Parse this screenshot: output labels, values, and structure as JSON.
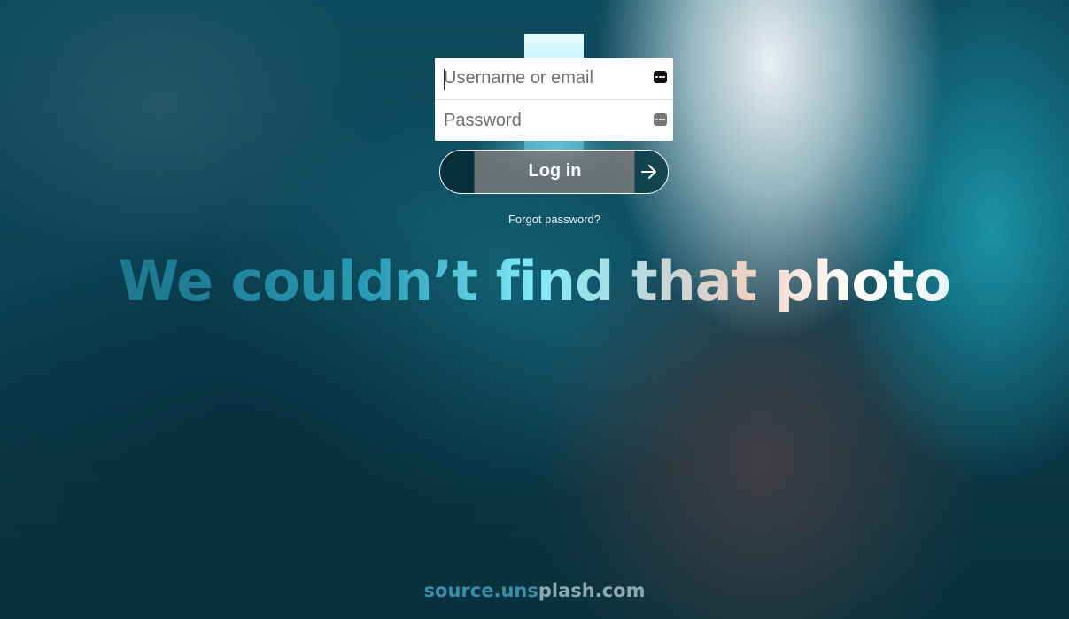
{
  "login": {
    "username_placeholder": "Username or email",
    "username_value": "",
    "password_placeholder": "Password",
    "password_value": "",
    "field_icon": "password-manager-icon",
    "submit_label": "Log in",
    "submit_icon": "arrow-right-icon",
    "forgot_link": "Forgot password?"
  },
  "error": {
    "headline": "We couldn’t find that photo"
  },
  "footer": {
    "domain_part1": "source.uns",
    "domain_part2": "plash.com"
  },
  "colors": {
    "background": "#0b4356",
    "card": "#ffffff",
    "button_border": "#ffffff",
    "headline_start": "#1a6e86",
    "headline_end": "#8df3ff",
    "footer_blue": "#3a8fa6"
  }
}
